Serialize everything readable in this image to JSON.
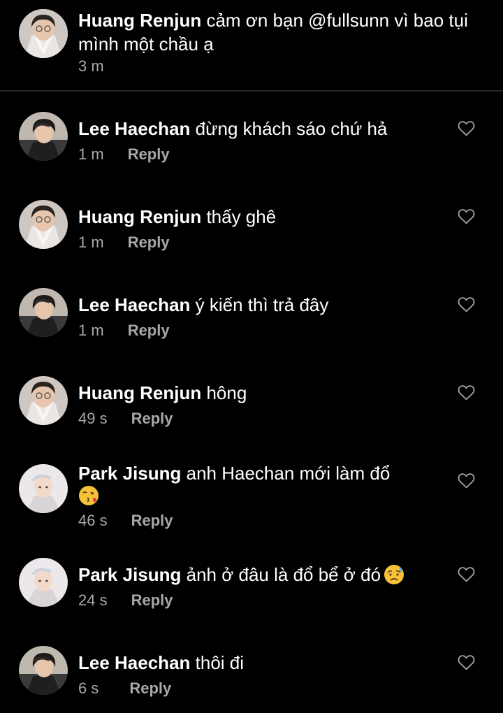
{
  "caption": {
    "username": "Huang Renjun",
    "text": " cảm ơn bạn @fullsunn vì bao tụi mình một chầu ạ",
    "time": "3 m"
  },
  "reply_label": "Reply",
  "comments": [
    {
      "username": "Lee Haechan",
      "text": " đừng khách sáo chứ hả",
      "time": "1 m"
    },
    {
      "username": "Huang Renjun",
      "text": " thấy ghê",
      "time": "1 m"
    },
    {
      "username": "Lee Haechan",
      "text": " ý kiến thì trả đây",
      "time": "1 m"
    },
    {
      "username": "Huang Renjun",
      "text": " hông",
      "time": "49 s"
    },
    {
      "username": "Park Jisung",
      "text": " anh Haechan mới làm đổ",
      "time": "46 s",
      "emoji": "face-blowing-kiss-emoji"
    },
    {
      "username": "Park Jisung",
      "text": " ảnh ở đâu là đổ bể ở đó",
      "time": "24 s",
      "emoji": "sad-sweat-face-emoji"
    },
    {
      "username": "Lee Haechan",
      "text": " thôi đi",
      "time": "6 s"
    }
  ],
  "icons": {
    "like": "heart-outline-icon"
  },
  "colors": {
    "background": "#000000",
    "text": "#ffffff",
    "secondary_text": "#a8a8a8",
    "divider": "#262626"
  }
}
